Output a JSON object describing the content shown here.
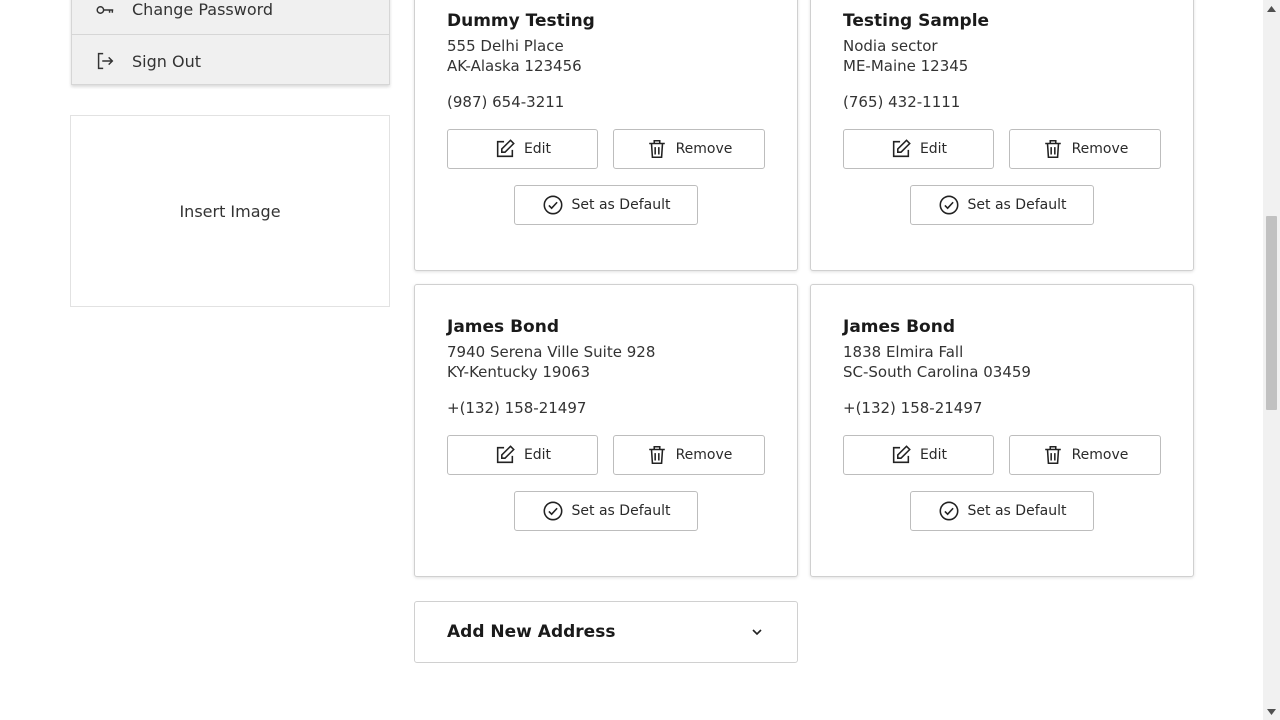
{
  "sidebar": {
    "menu": [
      {
        "label": "Change Password",
        "icon": "key-icon"
      },
      {
        "label": "Sign Out",
        "icon": "sign-out-icon"
      }
    ],
    "insert_image": "Insert Image"
  },
  "addresses": [
    {
      "name": "Dummy Testing",
      "line1": "555 Delhi Place",
      "line2": "AK-Alaska 123456",
      "phone": "(987) 654-3211"
    },
    {
      "name": "Testing Sample",
      "line1": "Nodia sector",
      "line2": "ME-Maine 12345",
      "phone": "(765) 432-1111"
    },
    {
      "name": "James Bond",
      "line1": "7940 Serena Ville Suite 928",
      "line2": "KY-Kentucky 19063",
      "phone": "+(132) 158-21497"
    },
    {
      "name": "James Bond",
      "line1": "1838 Elmira Fall",
      "line2": "SC-South Carolina 03459",
      "phone": "+(132) 158-21497"
    }
  ],
  "buttons": {
    "edit": "Edit",
    "remove": "Remove",
    "set_default": "Set as Default"
  },
  "add_new": {
    "label": "Add New Address",
    "icon": "chevron-down-icon"
  }
}
